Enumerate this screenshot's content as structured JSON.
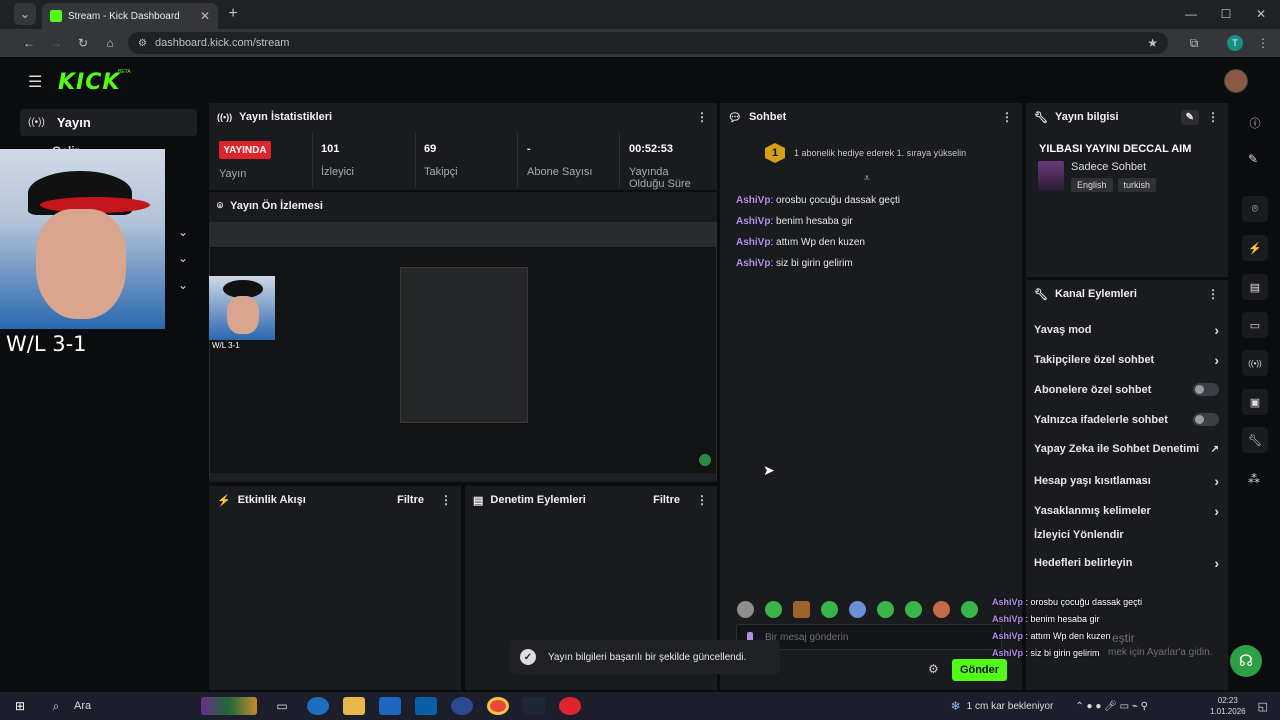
{
  "browser": {
    "tab_title": "Stream - Kick Dashboard",
    "url": "dashboard.kick.com/stream",
    "profile_initial": "T"
  },
  "app": {
    "logo": "KICK",
    "beta": "BETA"
  },
  "sidebar": {
    "stream_label": "Yayın",
    "partial_item": "Gelir"
  },
  "webcam": {
    "score": "W/L 3-1",
    "preview_score": "W/L 3-1"
  },
  "stats": {
    "title": "Yayın İstatistikleri",
    "live_badge": "YAYINDA",
    "live_label": "Yayın",
    "viewers": "101",
    "viewers_label": "İzleyici",
    "followers": "69",
    "followers_label": "Takipçi",
    "subs": "-",
    "subs_label": "Abone Sayısı",
    "uptime": "00:52:53",
    "uptime_label": "Yayında Olduğu Süre"
  },
  "preview": {
    "title": "Yayın Ön İzlemesi"
  },
  "activity": {
    "title": "Etkinlik Akışı",
    "filter": "Filtre"
  },
  "moderation": {
    "title": "Denetim Eylemleri",
    "filter": "Filtre"
  },
  "chat": {
    "title": "Sohbet",
    "gift_rank": "1",
    "gift_text": "1 abonelik hediye ederek 1. sıraya yükselin",
    "messages": [
      {
        "user": "AshiVp",
        "text": ": orosbu çocuğu dassak geçti"
      },
      {
        "user": "AshiVp",
        "text": ": benim hesaba gir"
      },
      {
        "user": "AshiVp",
        "text": ": attım Wp den kuzen"
      },
      {
        "user": "AshiVp",
        "text": ": siz bi girin gelirim"
      }
    ],
    "placeholder": "Bir mesaj gönderin",
    "send": "Gönder"
  },
  "overlay_chat": [
    {
      "user": "AshiVp",
      "text": " : orosbu çocuğu dassak geçti"
    },
    {
      "user": "AshiVp",
      "text": " : benim hesaba gir"
    },
    {
      "user": "AshiVp",
      "text": " : attım Wp den kuzen"
    },
    {
      "user": "AshiVp",
      "text": " : siz bi girin gelirim"
    }
  ],
  "overlay_faded": {
    "activate": "eştir",
    "settings_hint": "mek için Ayarlar'a gidin."
  },
  "toast": "Yayın bilgileri başarılı bir şekilde güncellendi.",
  "stream_info": {
    "title": "Yayın bilgisi",
    "stream_title": "YILBASI YAYINI DECCAL AIM",
    "category": "Sadece Sohbet",
    "tags": [
      "English",
      "turkish"
    ]
  },
  "channel_actions": {
    "title": "Kanal Eylemleri",
    "items": [
      "Yavaş mod",
      "Takipçilere özel sohbet",
      "Abonelere özel sohbet",
      "Yalnızca ifadelerle sohbet",
      "Yapay Zeka ile Sohbet Denetimi",
      "Hesap yaşı kısıtlaması",
      "Yasaklanmış kelimeler",
      "İzleyici Yönlendir",
      "Hedefleri belirleyin"
    ]
  },
  "taskbar": {
    "search": "Ara",
    "weather": "1 cm kar bekleniyor",
    "time": "02:23",
    "date": "1.01.2026"
  },
  "colors": {
    "accent": "#53fc18",
    "live": "#e0242e",
    "bg": "#0b0c0e",
    "panel": "#191b1f"
  }
}
